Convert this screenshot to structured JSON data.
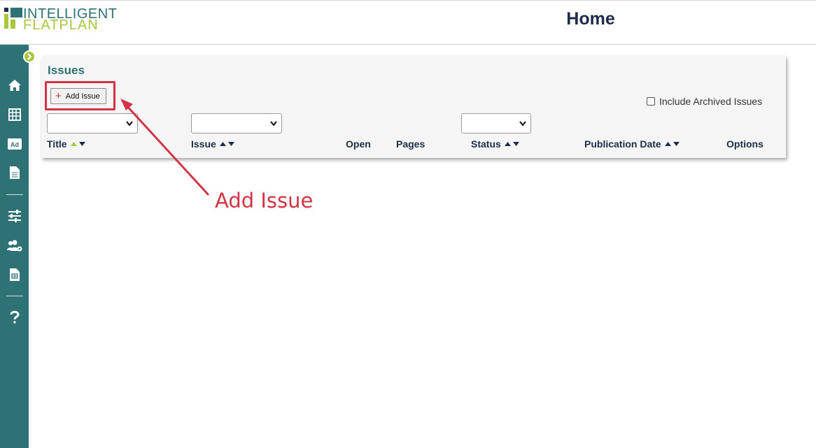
{
  "header": {
    "logo_line1": "INTELLIGENT",
    "logo_line2": "FLATPLAN",
    "title": "Home"
  },
  "sidebar": {
    "toggle_icon": "chevron-right-icon",
    "items": [
      {
        "icon": "home-icon"
      },
      {
        "icon": "grid-icon"
      },
      {
        "icon": "ad-icon",
        "label": "Ad"
      },
      {
        "icon": "document-icon"
      },
      {
        "icon": "sliders-icon"
      },
      {
        "icon": "users-gear-icon"
      },
      {
        "icon": "report-icon"
      },
      {
        "icon": "help-icon"
      }
    ]
  },
  "issues": {
    "title": "Issues",
    "add_label": "Add Issue",
    "archive_label": "Include Archived Issues",
    "columns": [
      "Title",
      "Issue",
      "Open",
      "Pages",
      "Status",
      "Publication Date",
      "Options"
    ]
  },
  "annotation": {
    "label": "Add Issue"
  },
  "colors": {
    "teal": "#2e7275",
    "lime": "#a7c73c",
    "navy": "#1d2c4a",
    "annotation_red": "#d13445"
  }
}
